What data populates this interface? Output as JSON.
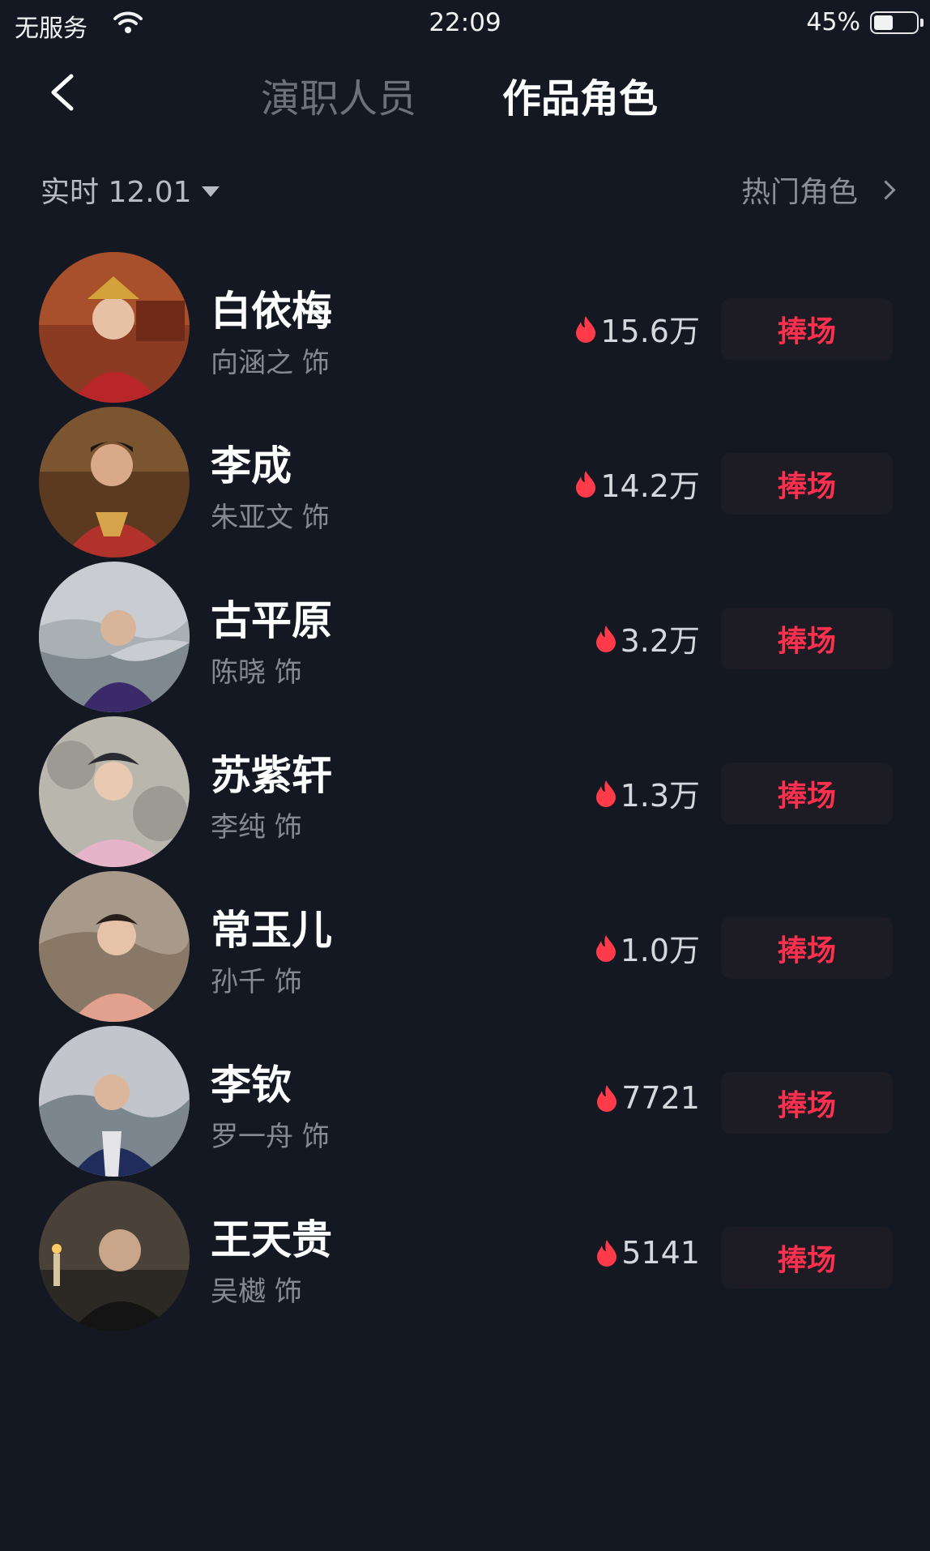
{
  "status_bar": {
    "carrier": "无服务",
    "time": "22:09",
    "battery_pct": "45%",
    "battery_level": 0.45
  },
  "nav": {
    "tabs": [
      {
        "label": "演职人员",
        "active": false
      },
      {
        "label": "作品角色",
        "active": true
      }
    ]
  },
  "filter": {
    "date_label": "实时 12.01",
    "hot_label": "热门角色"
  },
  "characters": [
    {
      "name": "白依梅",
      "actor": "向涵之 饰",
      "heat": "15.6万",
      "button": "捧场"
    },
    {
      "name": "李成",
      "actor": "朱亚文 饰",
      "heat": "14.2万",
      "button": "捧场"
    },
    {
      "name": "古平原",
      "actor": "陈晓 饰",
      "heat": "3.2万",
      "button": "捧场"
    },
    {
      "name": "苏紫轩",
      "actor": "李纯 饰",
      "heat": "1.3万",
      "button": "捧场"
    },
    {
      "name": "常玉儿",
      "actor": "孙千 饰",
      "heat": "1.0万",
      "button": "捧场"
    },
    {
      "name": "李钦",
      "actor": "罗一舟 饰",
      "heat": "7721",
      "button": "捧场"
    },
    {
      "name": "王天贵",
      "actor": "吴樾 饰",
      "heat": "5141",
      "button": "捧场"
    }
  ],
  "colors": {
    "background": "#141822",
    "accent": "#ff2f4e",
    "flame": "#ff3b4a"
  }
}
